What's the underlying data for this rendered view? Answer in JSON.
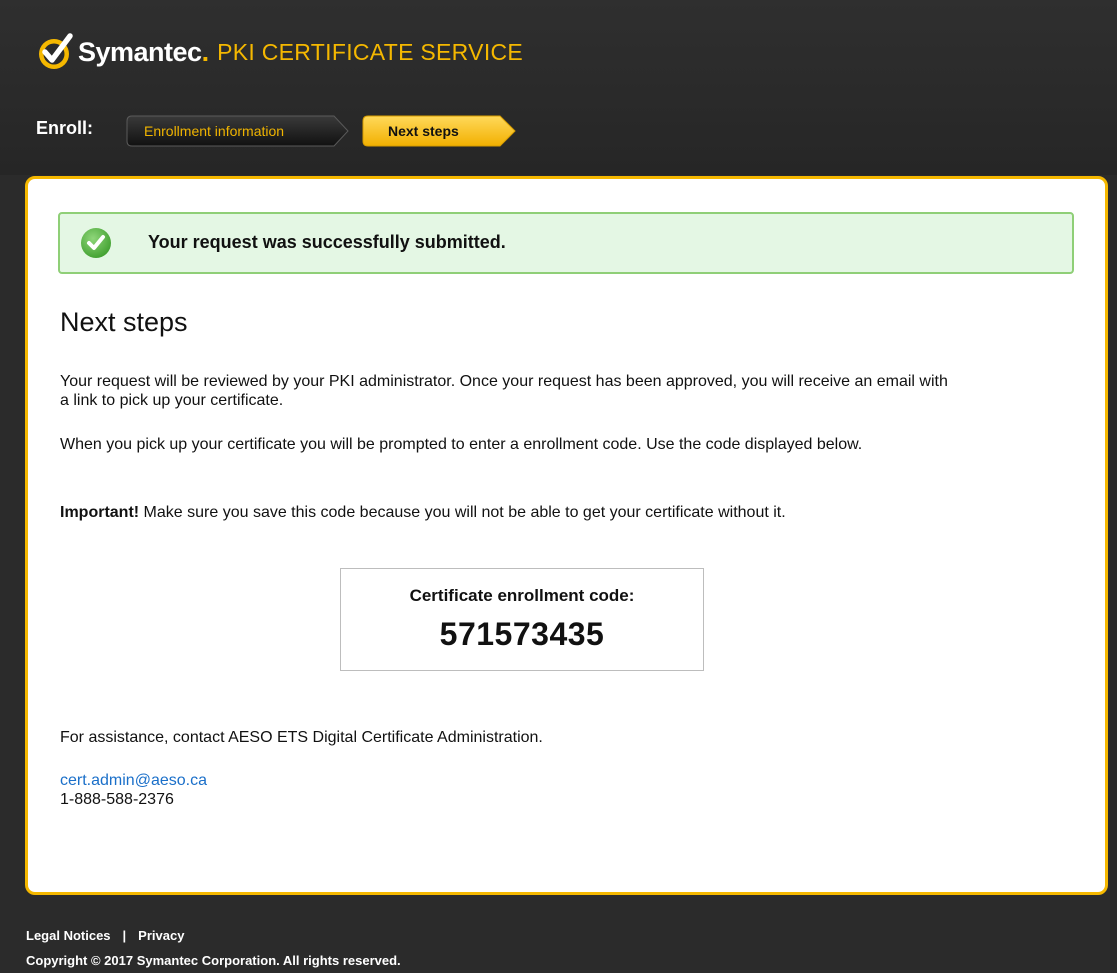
{
  "header": {
    "brand_name": "Symantec",
    "brand_dot": ".",
    "service_name": "PKI CERTIFICATE SERVICE"
  },
  "steps": {
    "label": "Enroll:",
    "items": [
      {
        "label": "Enrollment information",
        "state": "completed"
      },
      {
        "label": "Next steps",
        "state": "active"
      }
    ]
  },
  "success": {
    "icon": "check-circle-icon",
    "message": "Your request was successfully submitted."
  },
  "main": {
    "heading": "Next steps",
    "paragraph_1": "Your request will be reviewed by your PKI administrator. Once your request has been approved, you will receive an email with a link to pick up your certificate.",
    "paragraph_2": "When you pick up your certificate you will be prompted to enter a enrollment code. Use the code displayed below.",
    "important_label": "Important!",
    "important_text": " Make sure you save this code because you will not be able to get your certificate without it.",
    "code_label": "Certificate enrollment code:",
    "code_value": "571573435",
    "assistance": "For assistance, contact AESO ETS Digital Certificate Administration.",
    "email": "cert.admin@aeso.ca",
    "phone": "1-888-588-2376"
  },
  "footer": {
    "legal": "Legal Notices",
    "separator": "|",
    "privacy": "Privacy",
    "copyright": "Copyright © 2017 Symantec Corporation. All rights reserved."
  },
  "colors": {
    "accent": "#f5b800",
    "background": "#2b2b2b",
    "success_bg": "#e4f7e4",
    "success_border": "#8fcf77",
    "link": "#1a6fc9"
  }
}
